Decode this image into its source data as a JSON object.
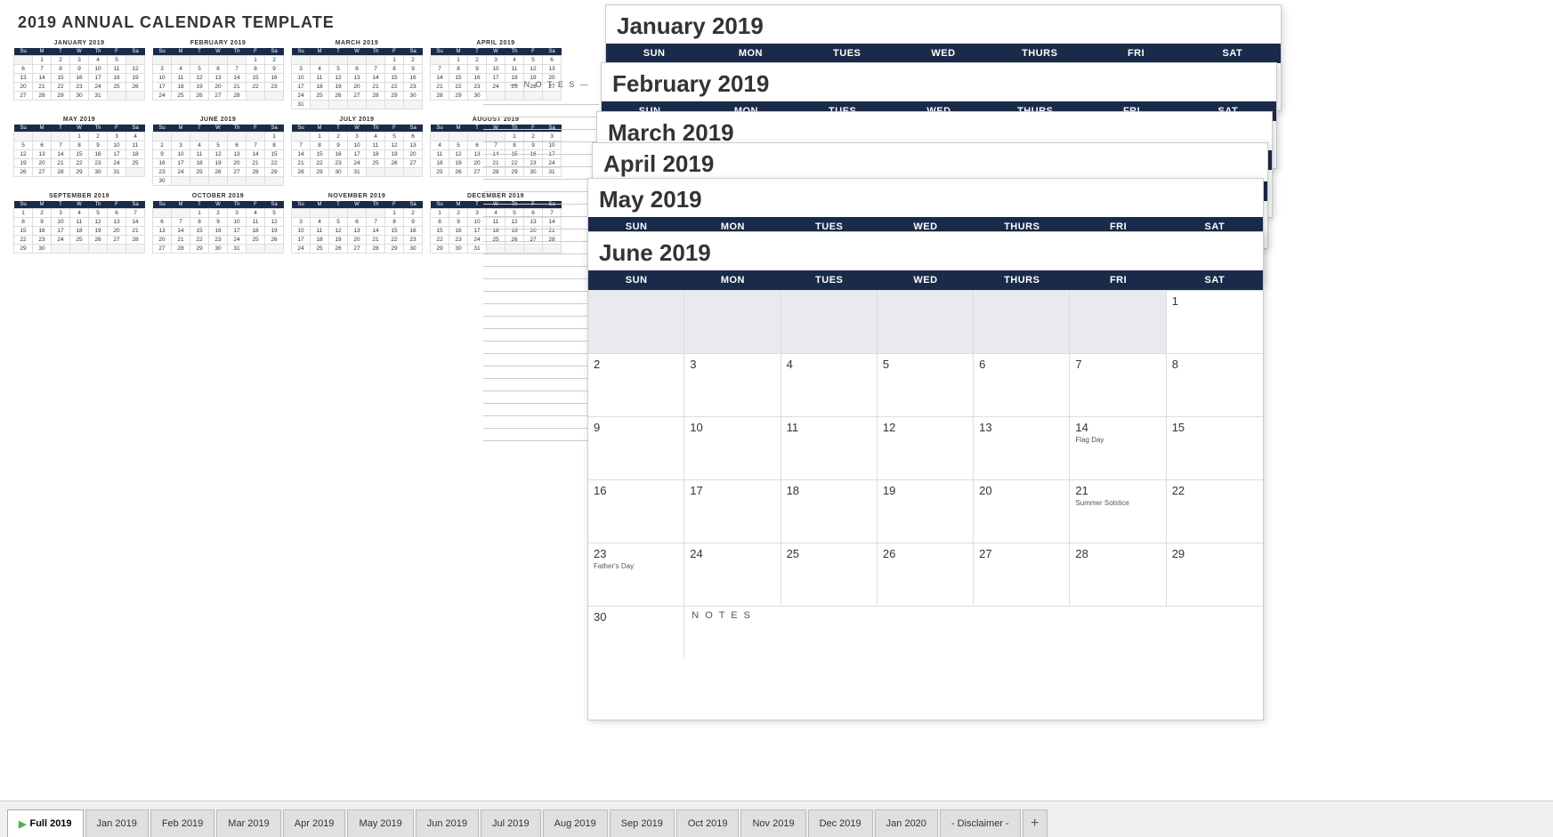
{
  "title": "2019 ANNUAL CALENDAR TEMPLATE",
  "notes_title": "— N O T E S —",
  "small_calendars": [
    {
      "id": "jan",
      "title": "JANUARY 2019",
      "headers": [
        "Su",
        "M",
        "T",
        "W",
        "Th",
        "F",
        "Sa"
      ],
      "weeks": [
        [
          "",
          "1",
          "2",
          "3",
          "4",
          "5",
          ""
        ],
        [
          "6",
          "7",
          "8",
          "9",
          "10",
          "11",
          "12"
        ],
        [
          "13",
          "14",
          "15",
          "16",
          "17",
          "18",
          "19"
        ],
        [
          "20",
          "21",
          "22",
          "23",
          "24",
          "25",
          "26"
        ],
        [
          "27",
          "28",
          "29",
          "30",
          "31",
          "",
          ""
        ]
      ]
    },
    {
      "id": "feb",
      "title": "FEBRUARY 2019",
      "headers": [
        "Su",
        "M",
        "T",
        "W",
        "Th",
        "F",
        "Sa"
      ],
      "weeks": [
        [
          "",
          "",
          "",
          "",
          "",
          "1",
          "2"
        ],
        [
          "3",
          "4",
          "5",
          "6",
          "7",
          "8",
          "9"
        ],
        [
          "10",
          "11",
          "12",
          "13",
          "14",
          "15",
          "16"
        ],
        [
          "17",
          "18",
          "19",
          "20",
          "21",
          "22",
          "23"
        ],
        [
          "24",
          "25",
          "26",
          "27",
          "28",
          "",
          ""
        ]
      ]
    },
    {
      "id": "mar",
      "title": "MARCH 2019",
      "headers": [
        "Su",
        "M",
        "T",
        "W",
        "Th",
        "F",
        "Sa"
      ],
      "weeks": [
        [
          "",
          "",
          "",
          "",
          "",
          "1",
          "2"
        ],
        [
          "3",
          "4",
          "5",
          "6",
          "7",
          "8",
          "9"
        ],
        [
          "10",
          "11",
          "12",
          "13",
          "14",
          "15",
          "16"
        ],
        [
          "17",
          "18",
          "19",
          "20",
          "21",
          "22",
          "23"
        ],
        [
          "24",
          "25",
          "26",
          "27",
          "28",
          "29",
          "30"
        ],
        [
          "31",
          "",
          "",
          "",
          "",
          "",
          ""
        ]
      ]
    },
    {
      "id": "apr",
      "title": "APRIL 2019",
      "headers": [
        "Su",
        "M",
        "T",
        "W",
        "Th",
        "F",
        "Sa"
      ],
      "weeks": [
        [
          "",
          "1",
          "2",
          "3",
          "4",
          "5",
          "6"
        ],
        [
          "7",
          "8",
          "9",
          "10",
          "11",
          "12",
          "13"
        ],
        [
          "14",
          "15",
          "16",
          "17",
          "18",
          "19",
          "20"
        ],
        [
          "21",
          "22",
          "23",
          "24",
          "25",
          "26",
          "27"
        ],
        [
          "28",
          "29",
          "30",
          "",
          "",
          "",
          ""
        ]
      ]
    },
    {
      "id": "may",
      "title": "MAY 2019",
      "headers": [
        "Su",
        "M",
        "T",
        "W",
        "Th",
        "F",
        "Sa"
      ],
      "weeks": [
        [
          "",
          "",
          "",
          "1",
          "2",
          "3",
          "4"
        ],
        [
          "5",
          "6",
          "7",
          "8",
          "9",
          "10",
          "11"
        ],
        [
          "12",
          "13",
          "14",
          "15",
          "16",
          "17",
          "18"
        ],
        [
          "19",
          "20",
          "21",
          "22",
          "23",
          "24",
          "25"
        ],
        [
          "26",
          "27",
          "28",
          "29",
          "30",
          "31",
          ""
        ]
      ]
    },
    {
      "id": "jun",
      "title": "JUNE 2019",
      "headers": [
        "Su",
        "M",
        "T",
        "W",
        "Th",
        "F",
        "Sa"
      ],
      "weeks": [
        [
          "",
          "",
          "",
          "",
          "",
          "",
          "1"
        ],
        [
          "2",
          "3",
          "4",
          "5",
          "6",
          "7",
          "8"
        ],
        [
          "9",
          "10",
          "11",
          "12",
          "13",
          "14",
          "15"
        ],
        [
          "16",
          "17",
          "18",
          "19",
          "20",
          "21",
          "22"
        ],
        [
          "23",
          "24",
          "25",
          "26",
          "27",
          "28",
          "29"
        ],
        [
          "30",
          "",
          "",
          "",
          "",
          "",
          ""
        ]
      ]
    },
    {
      "id": "jul",
      "title": "JULY 2019",
      "headers": [
        "Su",
        "M",
        "T",
        "W",
        "Th",
        "F",
        "Sa"
      ],
      "weeks": [
        [
          "",
          "1",
          "2",
          "3",
          "4",
          "5",
          "6"
        ],
        [
          "7",
          "8",
          "9",
          "10",
          "11",
          "12",
          "13"
        ],
        [
          "14",
          "15",
          "16",
          "17",
          "18",
          "19",
          "20"
        ],
        [
          "21",
          "22",
          "23",
          "24",
          "25",
          "26",
          "27"
        ],
        [
          "28",
          "29",
          "30",
          "31",
          "",
          "",
          ""
        ]
      ]
    },
    {
      "id": "aug",
      "title": "AUGUST 2019",
      "headers": [
        "Su",
        "M",
        "T",
        "W",
        "Th",
        "F",
        "Sa"
      ],
      "weeks": [
        [
          "",
          "",
          "",
          "",
          "1",
          "2",
          "3"
        ],
        [
          "4",
          "5",
          "6",
          "7",
          "8",
          "9",
          "10"
        ],
        [
          "11",
          "12",
          "13",
          "14",
          "15",
          "16",
          "17"
        ],
        [
          "18",
          "19",
          "20",
          "21",
          "22",
          "23",
          "24"
        ],
        [
          "25",
          "26",
          "27",
          "28",
          "29",
          "30",
          "31"
        ]
      ]
    },
    {
      "id": "sep",
      "title": "SEPTEMBER 2019",
      "headers": [
        "Su",
        "M",
        "T",
        "W",
        "Th",
        "F",
        "Sa"
      ],
      "weeks": [
        [
          "1",
          "2",
          "3",
          "4",
          "5",
          "6",
          "7"
        ],
        [
          "8",
          "9",
          "10",
          "11",
          "12",
          "13",
          "14"
        ],
        [
          "15",
          "16",
          "17",
          "18",
          "19",
          "20",
          "21"
        ],
        [
          "22",
          "23",
          "24",
          "25",
          "26",
          "27",
          "28"
        ],
        [
          "29",
          "30",
          "",
          "",
          "",
          "",
          ""
        ]
      ]
    },
    {
      "id": "oct",
      "title": "OCTOBER 2019",
      "headers": [
        "Su",
        "M",
        "T",
        "W",
        "Th",
        "F",
        "Sa"
      ],
      "weeks": [
        [
          "",
          "",
          "1",
          "2",
          "3",
          "4",
          "5"
        ],
        [
          "6",
          "7",
          "8",
          "9",
          "10",
          "11",
          "12"
        ],
        [
          "13",
          "14",
          "15",
          "16",
          "17",
          "18",
          "19"
        ],
        [
          "20",
          "21",
          "22",
          "23",
          "24",
          "25",
          "26"
        ],
        [
          "27",
          "28",
          "29",
          "30",
          "31",
          "",
          ""
        ]
      ]
    },
    {
      "id": "nov",
      "title": "NOVEMBER 2019",
      "headers": [
        "Su",
        "M",
        "T",
        "W",
        "Th",
        "F",
        "Sa"
      ],
      "weeks": [
        [
          "",
          "",
          "",
          "",
          "",
          "1",
          "2"
        ],
        [
          "3",
          "4",
          "5",
          "6",
          "7",
          "8",
          "9"
        ],
        [
          "10",
          "11",
          "12",
          "13",
          "14",
          "15",
          "16"
        ],
        [
          "17",
          "18",
          "19",
          "20",
          "21",
          "22",
          "23"
        ],
        [
          "24",
          "25",
          "26",
          "27",
          "28",
          "29",
          "30"
        ]
      ]
    },
    {
      "id": "dec",
      "title": "DECEMBER 2019",
      "headers": [
        "Su",
        "M",
        "T",
        "W",
        "Th",
        "F",
        "Sa"
      ],
      "weeks": [
        [
          "1",
          "2",
          "3",
          "4",
          "5",
          "6",
          "7"
        ],
        [
          "8",
          "9",
          "10",
          "11",
          "12",
          "13",
          "14"
        ],
        [
          "15",
          "16",
          "17",
          "18",
          "19",
          "20",
          "21"
        ],
        [
          "22",
          "23",
          "24",
          "25",
          "26",
          "27",
          "28"
        ],
        [
          "29",
          "30",
          "31",
          "",
          "",
          "",
          ""
        ]
      ]
    }
  ],
  "large_cal": {
    "jan_title": "January 2019",
    "feb_title": "February 2019",
    "mar_title": "March 2019",
    "apr_title": "April 2019",
    "may_title": "May 2019",
    "jun_title": "June 2019",
    "headers": [
      "SUN",
      "MON",
      "TUES",
      "WED",
      "THURS",
      "FRI",
      "SAT"
    ],
    "jun_weeks": [
      [
        {
          "num": "",
          "note": "",
          "empty": true
        },
        {
          "num": "",
          "note": "",
          "empty": true
        },
        {
          "num": "",
          "note": "",
          "empty": true
        },
        {
          "num": "",
          "note": "",
          "empty": true
        },
        {
          "num": "",
          "note": "",
          "empty": true
        },
        {
          "num": "",
          "note": "",
          "empty": true
        },
        {
          "num": "1",
          "note": "",
          "empty": false
        }
      ],
      [
        {
          "num": "2",
          "note": "",
          "empty": false
        },
        {
          "num": "3",
          "note": "",
          "empty": false
        },
        {
          "num": "4",
          "note": "",
          "empty": false
        },
        {
          "num": "5",
          "note": "",
          "empty": false
        },
        {
          "num": "6",
          "note": "",
          "empty": false
        },
        {
          "num": "7",
          "note": "",
          "empty": false
        },
        {
          "num": "8",
          "note": "",
          "empty": false
        }
      ],
      [
        {
          "num": "9",
          "note": "",
          "empty": false
        },
        {
          "num": "10",
          "note": "",
          "empty": false
        },
        {
          "num": "11",
          "note": "",
          "empty": false
        },
        {
          "num": "12",
          "note": "",
          "empty": false
        },
        {
          "num": "13",
          "note": "",
          "empty": false
        },
        {
          "num": "14",
          "note": "Flag Day",
          "empty": false
        },
        {
          "num": "15",
          "note": "",
          "empty": false
        }
      ],
      [
        {
          "num": "16",
          "note": "",
          "empty": false
        },
        {
          "num": "17",
          "note": "",
          "empty": false
        },
        {
          "num": "18",
          "note": "",
          "empty": false
        },
        {
          "num": "19",
          "note": "",
          "empty": false
        },
        {
          "num": "20",
          "note": "",
          "empty": false
        },
        {
          "num": "21",
          "note": "Summer Solstice",
          "empty": false
        },
        {
          "num": "22",
          "note": "",
          "empty": false
        }
      ],
      [
        {
          "num": "23",
          "note": "Father's Day",
          "empty": false
        },
        {
          "num": "24",
          "note": "",
          "empty": false
        },
        {
          "num": "25",
          "note": "",
          "empty": false
        },
        {
          "num": "26",
          "note": "",
          "empty": false
        },
        {
          "num": "27",
          "note": "",
          "empty": false
        },
        {
          "num": "28",
          "note": "",
          "empty": false
        },
        {
          "num": "29",
          "note": "",
          "empty": false
        }
      ],
      [
        {
          "num": "30",
          "note": "",
          "empty": false
        },
        {
          "num": "",
          "note": "",
          "empty": true
        },
        {
          "num": "",
          "note": "",
          "empty": true
        },
        {
          "num": "",
          "note": "",
          "empty": true
        },
        {
          "num": "",
          "note": "",
          "empty": true
        },
        {
          "num": "",
          "note": "",
          "empty": true
        },
        {
          "num": "",
          "note": "",
          "empty": true
        }
      ]
    ]
  },
  "tabs": [
    {
      "label": "Full 2019",
      "active": true
    },
    {
      "label": "Jan 2019",
      "active": false
    },
    {
      "label": "Feb 2019",
      "active": false
    },
    {
      "label": "Mar 2019",
      "active": false
    },
    {
      "label": "Apr 2019",
      "active": false
    },
    {
      "label": "May 2019",
      "active": false
    },
    {
      "label": "Jun 2019",
      "active": false
    },
    {
      "label": "Jul 2019",
      "active": false
    },
    {
      "label": "Aug 2019",
      "active": false
    },
    {
      "label": "Sep 2019",
      "active": false
    },
    {
      "label": "Oct 2019",
      "active": false
    },
    {
      "label": "Nov 2019",
      "active": false
    },
    {
      "label": "Dec 2019",
      "active": false
    },
    {
      "label": "Jan 2020",
      "active": false
    },
    {
      "label": "- Disclaimer -",
      "active": false
    }
  ],
  "add_sheet_label": "+"
}
